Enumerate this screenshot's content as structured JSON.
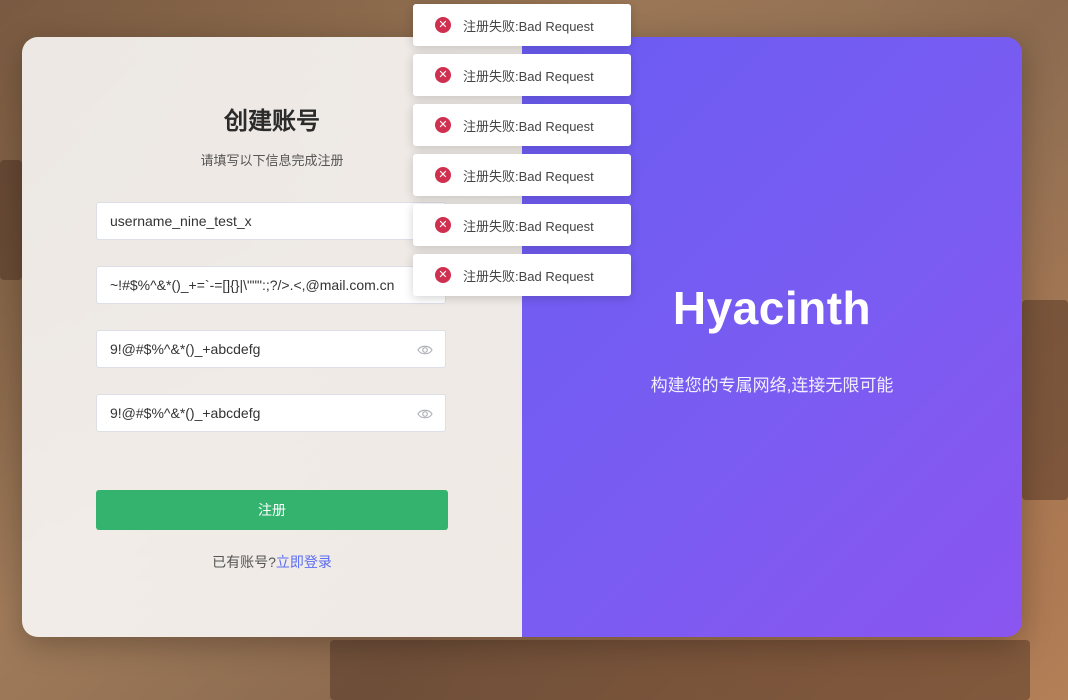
{
  "form": {
    "title": "创建账号",
    "subtitle": "请填写以下信息完成注册",
    "username_value": "username_nine_test_x",
    "email_value": "~!#$%^&*()_+=`-=[]{}|\\\"\"\":;?/>.<,@mail.com.cn",
    "password_value": "9!@#$%^&*()_+abcdefg",
    "confirm_value": "9!@#$%^&*()_+abcdefg",
    "submit_label": "注册",
    "login_prompt": "已有账号?",
    "login_link": "立即登录"
  },
  "brand": {
    "name": "Hyacinth",
    "tagline": "构建您的专属网络,连接无限可能"
  },
  "toasts": [
    {
      "icon": "error-icon",
      "message": "注册失败:Bad Request"
    },
    {
      "icon": "error-icon",
      "message": "注册失败:Bad Request"
    },
    {
      "icon": "error-icon",
      "message": "注册失败:Bad Request"
    },
    {
      "icon": "error-icon",
      "message": "注册失败:Bad Request"
    },
    {
      "icon": "error-icon",
      "message": "注册失败:Bad Request"
    },
    {
      "icon": "error-icon",
      "message": "注册失败:Bad Request"
    }
  ],
  "colors": {
    "accent": "#6b5cf2",
    "submit": "#34b36e",
    "error": "#d0304f",
    "link": "#5b6cf5"
  }
}
